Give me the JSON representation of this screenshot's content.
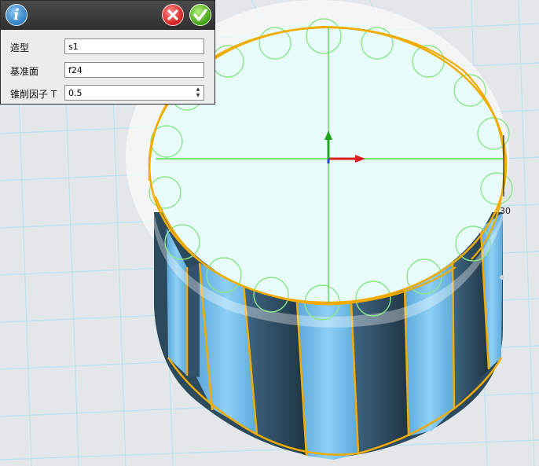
{
  "panel": {
    "info_icon": "info-icon",
    "close_icon": "close-icon",
    "confirm_icon": "check-icon",
    "fields": [
      {
        "label": "造型",
        "value": "s1"
      },
      {
        "label": "基准面",
        "value": "f24"
      },
      {
        "label": "锥削因子 T",
        "value": "0.5"
      }
    ]
  },
  "viewport": {
    "dimension_label": "30",
    "colors": {
      "grid_line": "#b7e3f1",
      "background": "#e4e7ea",
      "cylinder_light": "#76bce8",
      "cylinder_dark": "#2b4659",
      "top_face": "#e8fdfb",
      "edge_highlight": "#f2ab00",
      "axis_x": "#e02020",
      "axis_y": "#20b020"
    }
  }
}
